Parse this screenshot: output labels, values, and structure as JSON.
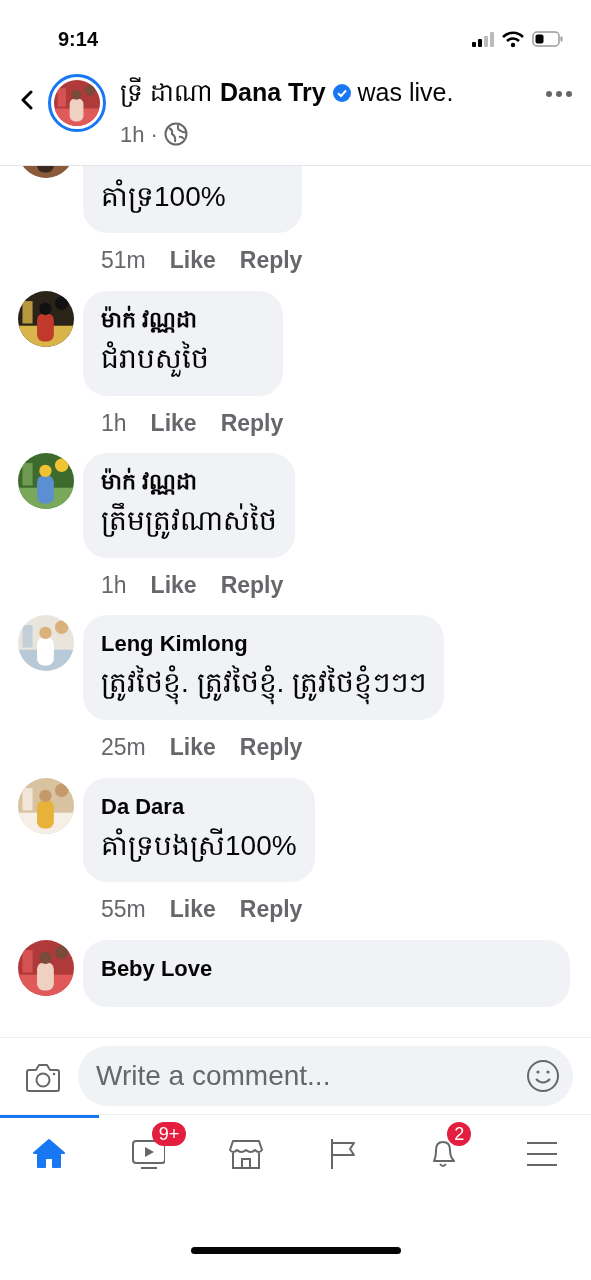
{
  "status_bar": {
    "time": "9:14"
  },
  "header": {
    "name_local": "ទ្រី ដាណា",
    "name": "Dana Try",
    "verified": true,
    "action": "was live.",
    "time": "1h",
    "separator": "·"
  },
  "comments": [
    {
      "text": "គាំទ្រ100%",
      "time": "51m",
      "like": "Like",
      "reply": "Reply",
      "cut_top": true
    },
    {
      "author": "ម៉ាក់ វណ្ណដា",
      "text": "ជំរាបសួថៃ",
      "time": "1h",
      "like": "Like",
      "reply": "Reply"
    },
    {
      "author": "ម៉ាក់ វណ្ណដា",
      "text": "ត្រឹមត្រូវណាស់ថៃ",
      "time": "1h",
      "like": "Like",
      "reply": "Reply"
    },
    {
      "author": "Leng Kimlong",
      "text": "ត្រូវថៃខ្ញុំ.  ត្រូវថៃខ្ញុំ. ត្រូវថៃខ្ញុំៗៗៗ",
      "time": "25m",
      "like": "Like",
      "reply": "Reply"
    },
    {
      "author": "Da Dara",
      "text": "គាំទ្របងស្រី100%",
      "time": "55m",
      "like": "Like",
      "reply": "Reply"
    },
    {
      "author": "Beby Love"
    }
  ],
  "composer": {
    "placeholder": "Write a comment..."
  },
  "tabs": [
    {
      "kind": "home",
      "selected": true
    },
    {
      "kind": "watch",
      "selected": false,
      "badge": "9+"
    },
    {
      "kind": "marketplace",
      "selected": false
    },
    {
      "kind": "pages",
      "selected": false
    },
    {
      "kind": "notifications",
      "selected": false,
      "badge": "2"
    },
    {
      "kind": "menu",
      "selected": false
    }
  ]
}
